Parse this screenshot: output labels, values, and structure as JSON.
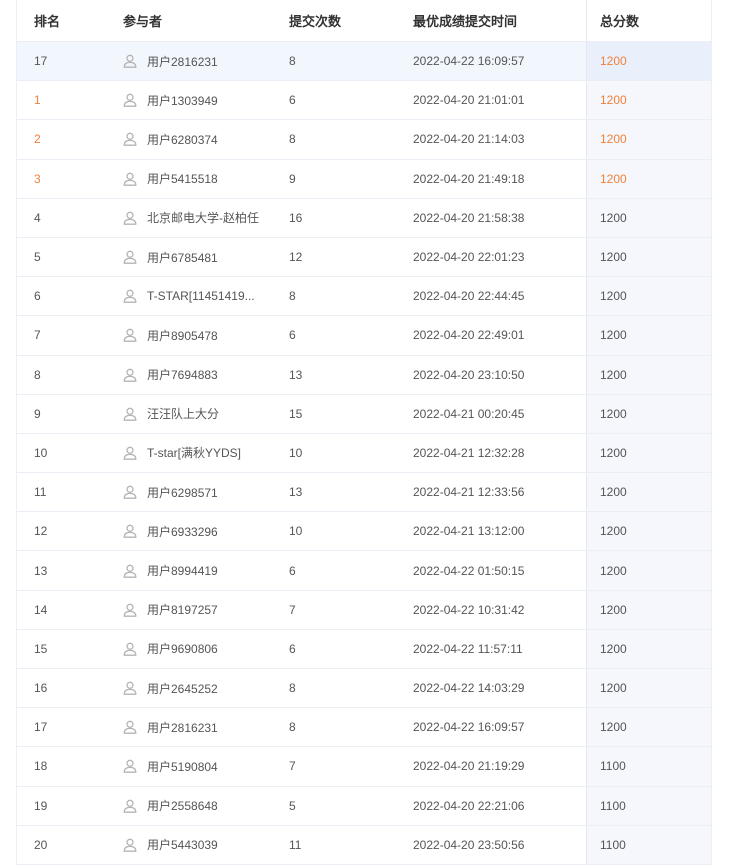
{
  "columns": {
    "rank": "排名",
    "participant": "参与者",
    "submissions": "提交次数",
    "best_time": "最优成绩提交时间",
    "total_score": "总分数"
  },
  "current_user_row": {
    "rank": "17",
    "user": "用户2816231",
    "submissions": "8",
    "time": "2022-04-22 16:09:57",
    "score": "1200"
  },
  "rows": [
    {
      "rank": "1",
      "user": "用户1303949",
      "submissions": "6",
      "time": "2022-04-20 21:01:01",
      "score": "1200"
    },
    {
      "rank": "2",
      "user": "用户6280374",
      "submissions": "8",
      "time": "2022-04-20 21:14:03",
      "score": "1200"
    },
    {
      "rank": "3",
      "user": "用户5415518",
      "submissions": "9",
      "time": "2022-04-20 21:49:18",
      "score": "1200"
    },
    {
      "rank": "4",
      "user": "北京邮电大学-赵柏任",
      "submissions": "16",
      "time": "2022-04-20 21:58:38",
      "score": "1200"
    },
    {
      "rank": "5",
      "user": "用户6785481",
      "submissions": "12",
      "time": "2022-04-20 22:01:23",
      "score": "1200"
    },
    {
      "rank": "6",
      "user": "T-STAR[11451419...",
      "submissions": "8",
      "time": "2022-04-20 22:44:45",
      "score": "1200"
    },
    {
      "rank": "7",
      "user": "用户8905478",
      "submissions": "6",
      "time": "2022-04-20 22:49:01",
      "score": "1200"
    },
    {
      "rank": "8",
      "user": "用户7694883",
      "submissions": "13",
      "time": "2022-04-20 23:10:50",
      "score": "1200"
    },
    {
      "rank": "9",
      "user": "汪汪队上大分",
      "submissions": "15",
      "time": "2022-04-21 00:20:45",
      "score": "1200"
    },
    {
      "rank": "10",
      "user": "T-star[满秋YYDS]",
      "submissions": "10",
      "time": "2022-04-21 12:32:28",
      "score": "1200"
    },
    {
      "rank": "11",
      "user": "用户6298571",
      "submissions": "13",
      "time": "2022-04-21 12:33:56",
      "score": "1200"
    },
    {
      "rank": "12",
      "user": "用户6933296",
      "submissions": "10",
      "time": "2022-04-21 13:12:00",
      "score": "1200"
    },
    {
      "rank": "13",
      "user": "用户8994419",
      "submissions": "6",
      "time": "2022-04-22 01:50:15",
      "score": "1200"
    },
    {
      "rank": "14",
      "user": "用户8197257",
      "submissions": "7",
      "time": "2022-04-22 10:31:42",
      "score": "1200"
    },
    {
      "rank": "15",
      "user": "用户9690806",
      "submissions": "6",
      "time": "2022-04-22 11:57:11",
      "score": "1200"
    },
    {
      "rank": "16",
      "user": "用户2645252",
      "submissions": "8",
      "time": "2022-04-22 14:03:29",
      "score": "1200"
    },
    {
      "rank": "17",
      "user": "用户2816231",
      "submissions": "8",
      "time": "2022-04-22 16:09:57",
      "score": "1200"
    },
    {
      "rank": "18",
      "user": "用户5190804",
      "submissions": "7",
      "time": "2022-04-20 21:19:29",
      "score": "1100"
    },
    {
      "rank": "19",
      "user": "用户2558648",
      "submissions": "5",
      "time": "2022-04-20 22:21:06",
      "score": "1100"
    },
    {
      "rank": "20",
      "user": "用户5443039",
      "submissions": "11",
      "time": "2022-04-20 23:50:56",
      "score": "1100"
    }
  ],
  "colors": {
    "top3_accent": "#f0803a",
    "icon_gray": "#b4b4b4",
    "highlight_row": "#f2f6fd"
  },
  "icons": {
    "participant": "user-icon"
  }
}
